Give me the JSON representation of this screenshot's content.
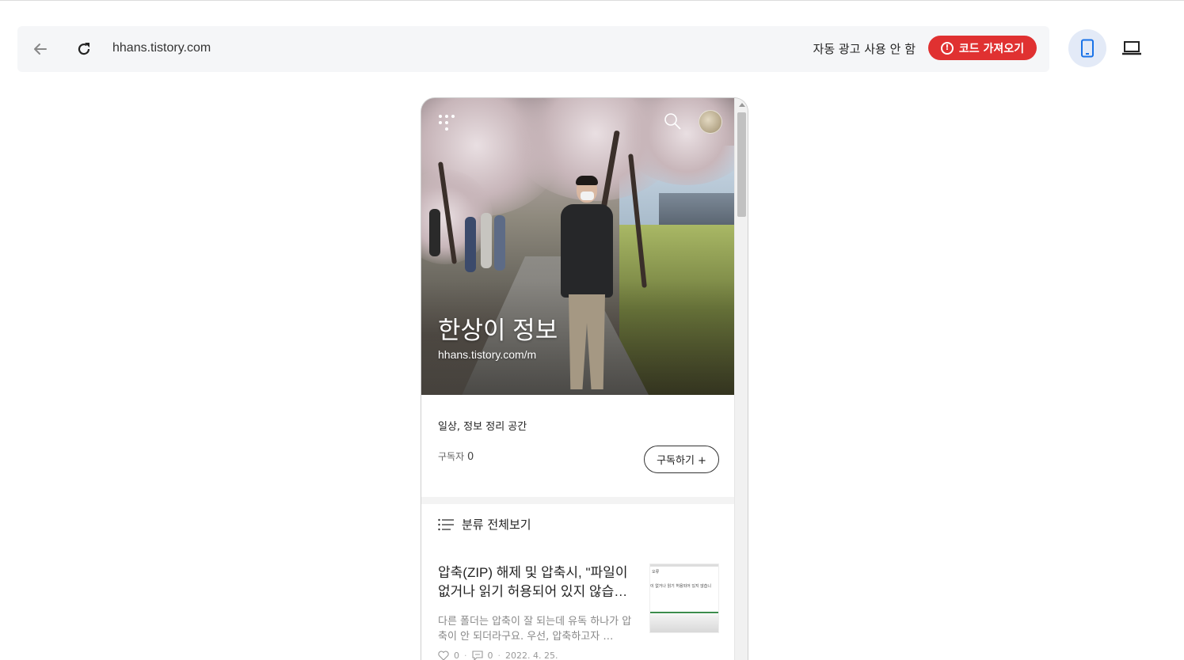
{
  "toolbar": {
    "url": "hhans.tistory.com",
    "ads_label": "자동 광고 사용 안 함",
    "code_button_label": "코드 가져오기",
    "back_icon": "arrow-left-icon",
    "reload_icon": "reload-icon",
    "mobile_view_icon": "smartphone-icon",
    "laptop_view_icon": "laptop-icon",
    "code_button_color": "#e03131",
    "active_view": "mobile"
  },
  "blog": {
    "title": "한상이 정보",
    "url": "hhans.tistory.com/m",
    "description": "일상, 정보 정리 공간",
    "subscribers_label": "구독자",
    "subscribers_count": "0",
    "subscribe_button": "구독하기 +",
    "category_label": "분류 전체보기"
  },
  "posts": [
    {
      "title": "압축(ZIP) 해제 및 압축시, \"파일이 없거나 읽기 허용되어 있지 않습…",
      "excerpt": "다른 폴더는 압축이 잘 되는데 유독 하나가 압축이 안 되더라구요. 우선, 압축하고자 …",
      "likes": "0",
      "comments": "0",
      "date": "2022. 4. 25.",
      "thumb_text_1": "오류",
      "thumb_text_2": "이 없거나 읽기 허용되어 있지 않습니"
    }
  ]
}
